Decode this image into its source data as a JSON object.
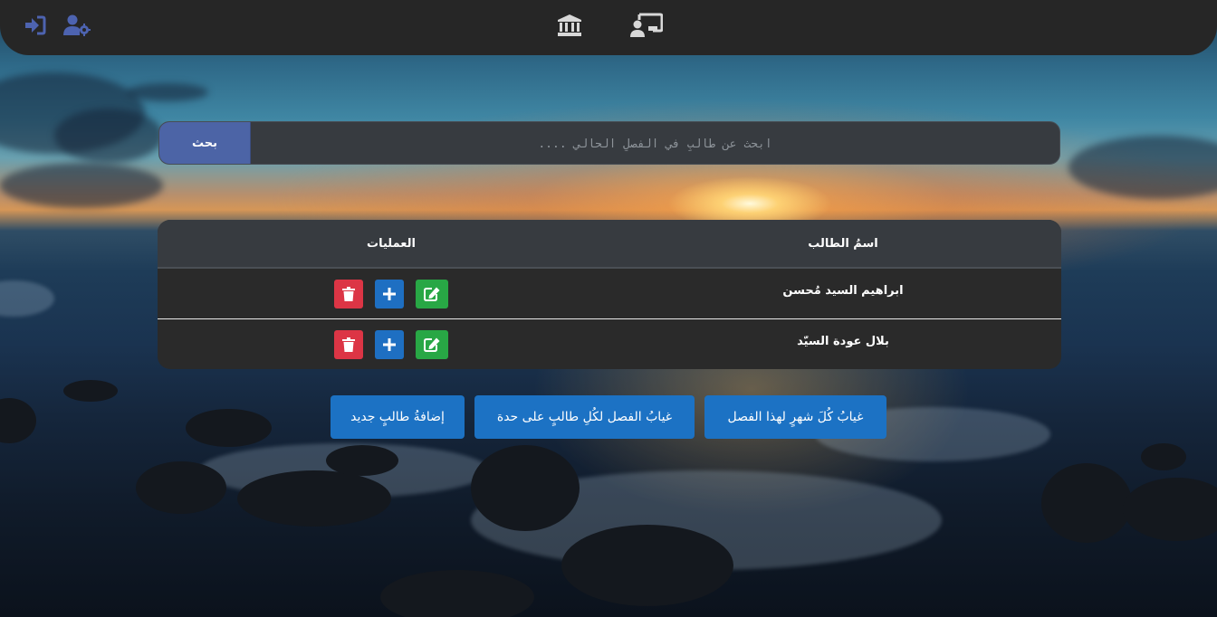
{
  "nav": {
    "icons": [
      "logout-icon",
      "user-settings-icon",
      "institution-icon",
      "classroom-teacher-icon"
    ]
  },
  "search": {
    "button_label": "بحث",
    "placeholder": "ابحث عن طالبٍ في الفصلِ الحالي ...."
  },
  "table": {
    "headers": {
      "name": "اسمُ الطالب",
      "operations": "العمليات"
    },
    "rows": [
      {
        "name": "ابراهيم السيد مُحسن"
      },
      {
        "name": "بلال عودة السيّد"
      }
    ]
  },
  "actions": {
    "add_student": "إضافةُ طالبٍ جديد",
    "class_absence_each_student": "غيابُ الفصل لكُلِ طالبٍ على حدة",
    "monthly_absence": "غيابُ كُلَ شهرٍ لهذا الفصل"
  },
  "colors": {
    "topbar": "#262626",
    "nav_icon_blue": "#4d63b0",
    "nav_icon_gray": "#d8d8d8",
    "search_button": "#4c64a6",
    "action_button": "#1c72c4",
    "delete": "#dc3545",
    "add": "#1e6fc2",
    "edit": "#28a745"
  }
}
